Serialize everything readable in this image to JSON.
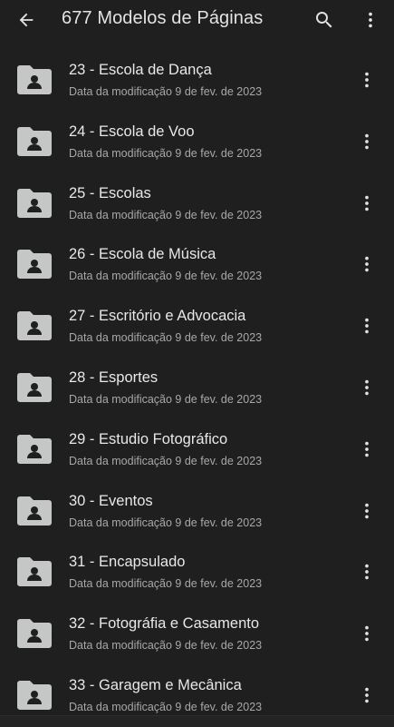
{
  "app_bar": {
    "title": "677 Modelos de Páginas",
    "back_icon": "arrow-back-icon",
    "search_icon": "search-icon",
    "more_icon": "more-vert-icon"
  },
  "colors": {
    "background": "#1f1f1f",
    "icon": "#e3e3e3",
    "folder": "#c4c7c5",
    "subtitle": "#a8a8a8"
  },
  "files": [
    {
      "name": "23 - Escola de Dança",
      "modified": "Data da modificação 9 de fev. de 2023"
    },
    {
      "name": "24 - Escola de Voo",
      "modified": "Data da modificação 9 de fev. de 2023"
    },
    {
      "name": "25 - Escolas",
      "modified": "Data da modificação 9 de fev. de 2023"
    },
    {
      "name": "26 - Escola de Música",
      "modified": "Data da modificação 9 de fev. de 2023"
    },
    {
      "name": "27 - Escritório e Advocacia",
      "modified": "Data da modificação 9 de fev. de 2023"
    },
    {
      "name": "28 - Esportes",
      "modified": "Data da modificação 9 de fev. de 2023"
    },
    {
      "name": "29 - Estudio Fotográfico",
      "modified": "Data da modificação 9 de fev. de 2023"
    },
    {
      "name": "30 - Eventos",
      "modified": "Data da modificação 9 de fev. de 2023"
    },
    {
      "name": "31 - Encapsulado",
      "modified": "Data da modificação 9 de fev. de 2023"
    },
    {
      "name": "32 - Fotográfia e Casamento",
      "modified": "Data da modificação 9 de fev. de 2023"
    },
    {
      "name": "33 - Garagem e Mecânica",
      "modified": "Data da modificação 9 de fev. de 2023"
    }
  ],
  "file_icon": "shared-folder-icon",
  "row_more_icon": "more-vert-icon"
}
